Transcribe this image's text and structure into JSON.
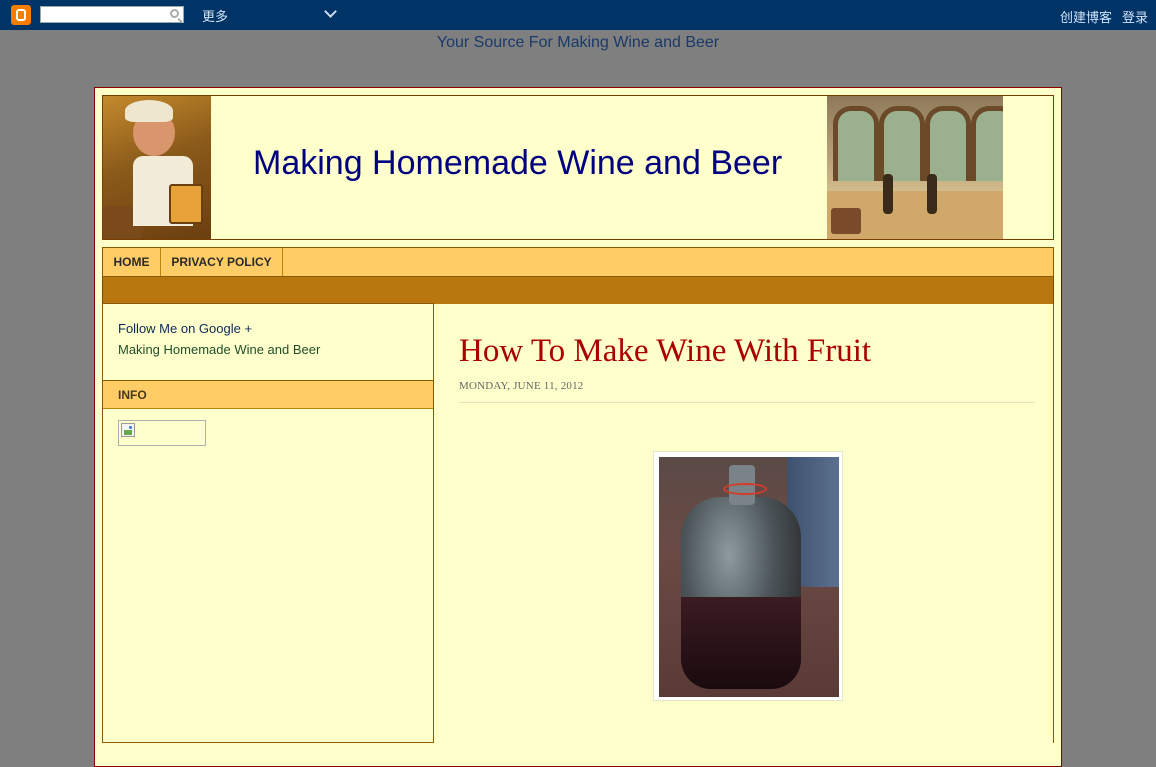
{
  "navbar": {
    "more_label": "更多",
    "create_blog_label": "创建博客",
    "login_label": "登录",
    "search_value": ""
  },
  "blog": {
    "tagline": "Your Source For Making Wine and Beer",
    "title": "Making Homemade Wine and Beer"
  },
  "tabs": [
    {
      "label": "HOME"
    },
    {
      "label": "PRIVACY POLICY"
    }
  ],
  "sidebar": {
    "follow_label": "Follow Me on Google +",
    "follow_sub": "Making Homemade Wine and Beer",
    "info_heading": "INFO"
  },
  "post": {
    "title": "How To Make Wine With Fruit",
    "date": "MONDAY, JUNE 11, 2012"
  },
  "colors": {
    "navbar": "#003366",
    "page_bg": "#7f7f7f",
    "content_bg": "#ffffcc",
    "tab_bar": "#ffcc66",
    "band": "#b8780f",
    "post_title": "#aa0000",
    "site_title": "#000080"
  }
}
